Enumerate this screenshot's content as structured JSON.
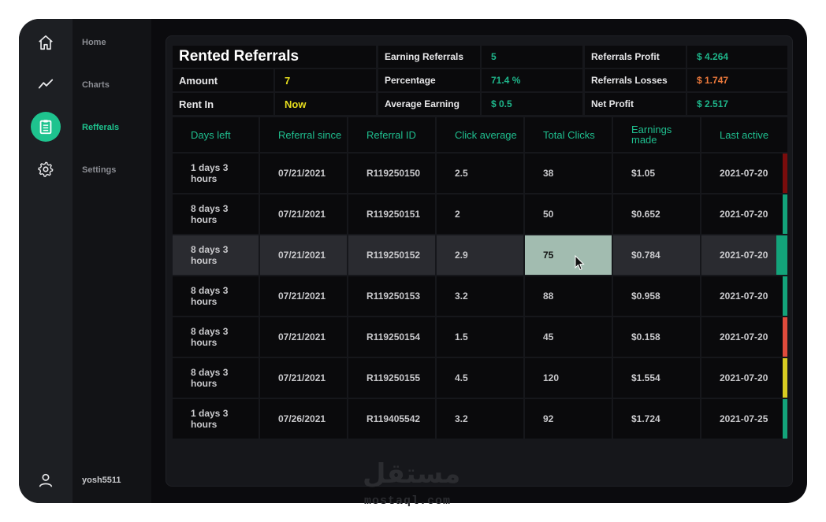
{
  "nav": {
    "items": [
      {
        "label": "Home",
        "icon": "home-icon"
      },
      {
        "label": "Charts",
        "icon": "chart-icon"
      },
      {
        "label": "Refferals",
        "icon": "clipboard-icon"
      },
      {
        "label": "Settings",
        "icon": "gear-icon"
      }
    ],
    "active": "Refferals",
    "user": "yosh5511",
    "accent_color": "#1ec38e"
  },
  "summary": {
    "title": "Rented Referrals",
    "amount_label": "Amount",
    "amount_value": "7",
    "rent_in_label": "Rent In",
    "rent_in_value": "Now",
    "earning_referrals_label": "Earning Referrals",
    "earning_referrals_value": "5",
    "percentage_label": "Percentage",
    "percentage_value": "71.4 %",
    "average_earning_label": "Average Earning",
    "average_earning_value": "$ 0.5",
    "referrals_profit_label": "Referrals Profit",
    "referrals_profit_value": "$ 4.264",
    "referrals_losses_label": "Referrals Losses",
    "referrals_losses_value": "$ 1.747",
    "net_profit_label": "Net Profit",
    "net_profit_value": "$ 2.517"
  },
  "table": {
    "headers": [
      "Days left",
      "Referral since",
      "Referral ID",
      "Click average",
      "Total Clicks",
      "Earnings made",
      "Last active"
    ],
    "rows": [
      {
        "days_left": "1 days 3 hours",
        "since": "07/21/2021",
        "id": "R119250150",
        "click_avg": "2.5",
        "total_clicks": "38",
        "earnings": "$1.05",
        "last_active": "2021-07-20",
        "status_color": "#7a0c0c"
      },
      {
        "days_left": "8 days 3 hours",
        "since": "07/21/2021",
        "id": "R119250151",
        "click_avg": "2",
        "total_clicks": "50",
        "earnings": "$0.652",
        "last_active": "2021-07-20",
        "status_color": "#13a37a"
      },
      {
        "days_left": "8 days 3 hours",
        "since": "07/21/2021",
        "id": "R119250152",
        "click_avg": "2.9",
        "total_clicks": "75",
        "earnings": "$0.784",
        "last_active": "2021-07-20",
        "status_color": "#13a37a"
      },
      {
        "days_left": "8 days 3 hours",
        "since": "07/21/2021",
        "id": "R119250153",
        "click_avg": "3.2",
        "total_clicks": "88",
        "earnings": "$0.958",
        "last_active": "2021-07-20",
        "status_color": "#13a37a"
      },
      {
        "days_left": "8 days 3 hours",
        "since": "07/21/2021",
        "id": "R119250154",
        "click_avg": "1.5",
        "total_clicks": "45",
        "earnings": "$0.158",
        "last_active": "2021-07-20",
        "status_color": "#e04b3c"
      },
      {
        "days_left": "8 days 3 hours",
        "since": "07/21/2021",
        "id": "R119250155",
        "click_avg": "4.5",
        "total_clicks": "120",
        "earnings": "$1.554",
        "last_active": "2021-07-20",
        "status_color": "#d8cc22"
      },
      {
        "days_left": "1 days 3 hours",
        "since": "07/26/2021",
        "id": "R119405542",
        "click_avg": "3.2",
        "total_clicks": "92",
        "earnings": "$1.724",
        "last_active": "2021-07-25",
        "status_color": "#13a37a"
      }
    ],
    "highlighted_row": 2
  },
  "watermark": {
    "arabic": "مستقل",
    "latin": "mostaql.com"
  }
}
